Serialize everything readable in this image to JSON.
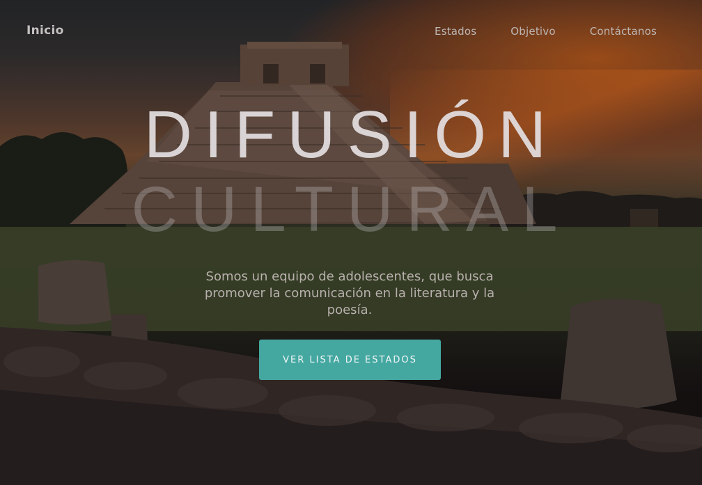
{
  "nav": {
    "brand": "Inicio",
    "links": [
      {
        "label": "Estados"
      },
      {
        "label": "Objetivo"
      },
      {
        "label": "Contáctanos"
      }
    ]
  },
  "hero": {
    "title_line1": "DIFUSIÓN",
    "title_line2": "CULTURAL",
    "subtitle": "Somos un equipo de adolescentes, que busca promover la comunicación en la literatura y la poesía.",
    "cta_label": "VER LISTA DE ESTADOS"
  },
  "colors": {
    "accent": "#44a8a1",
    "title": "#e4e0e2",
    "nav_text": "#bdb6b4"
  }
}
